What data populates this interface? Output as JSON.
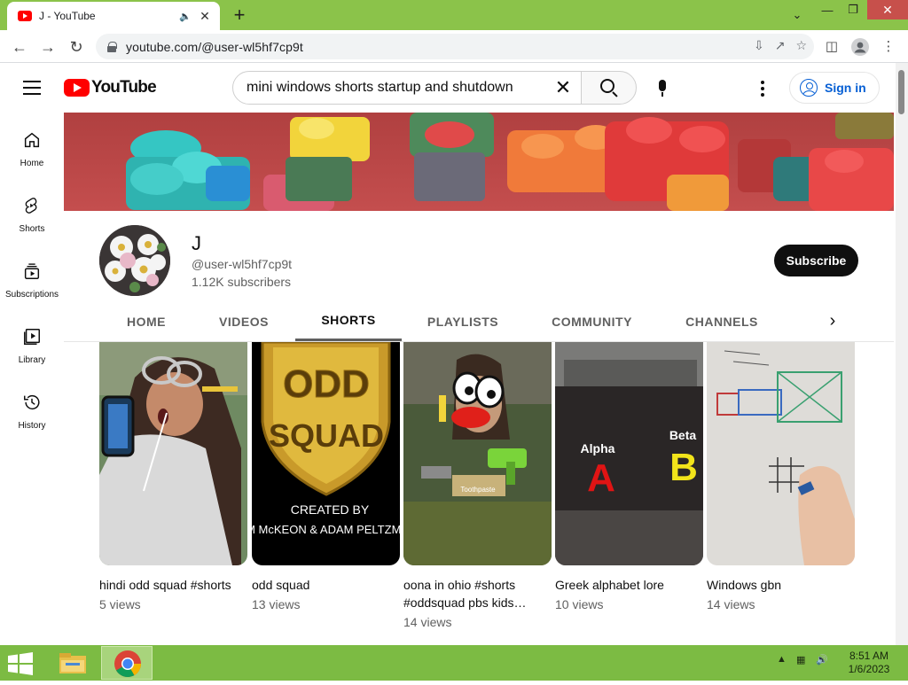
{
  "browser": {
    "tab_title": "J - YouTube",
    "url": "youtube.com/@user-wl5hf7cp9t"
  },
  "header": {
    "logo_text": "YouTube",
    "search_value": "mini windows shorts startup and shutdown",
    "signin_label": "Sign in"
  },
  "sidebar": {
    "items": [
      {
        "label": "Home",
        "icon": "home-icon"
      },
      {
        "label": "Shorts",
        "icon": "shorts-icon"
      },
      {
        "label": "Subscriptions",
        "icon": "subscriptions-icon"
      },
      {
        "label": "Library",
        "icon": "library-icon"
      },
      {
        "label": "History",
        "icon": "history-icon"
      }
    ]
  },
  "channel": {
    "name": "J",
    "handle": "@user-wl5hf7cp9t",
    "subscribers": "1.12K subscribers",
    "subscribe_label": "Subscribe"
  },
  "tabs": [
    {
      "label": "HOME",
      "active": false
    },
    {
      "label": "VIDEOS",
      "active": false
    },
    {
      "label": "SHORTS",
      "active": true
    },
    {
      "label": "PLAYLISTS",
      "active": false
    },
    {
      "label": "COMMUNITY",
      "active": false
    },
    {
      "label": "CHANNELS",
      "active": false
    }
  ],
  "shorts": [
    {
      "title": "hindi odd squad #shorts",
      "views": "5 views"
    },
    {
      "title": "odd squad",
      "views": "13 views"
    },
    {
      "title": "oona in ohio #shorts #oddsquad pbs kids…",
      "views": "14 views"
    },
    {
      "title": "Greek alphabet lore",
      "views": "10 views"
    },
    {
      "title": "Windows gbn",
      "views": "14 views"
    }
  ],
  "thumb_text": {
    "odd_line1": "ODD",
    "odd_line2": "SQUAD",
    "created_by": "CREATED BY",
    "creators": "TIM McKEON & ADAM PELTZMAN",
    "toothpaste": "Toothpaste",
    "alpha_label": "Alpha",
    "alpha_letter": "A",
    "beta_label": "Beta",
    "beta_letter": "B"
  },
  "taskbar": {
    "time": "8:51 AM",
    "date": "1/6/2023"
  },
  "colors": {
    "accent_link": "#065fd4",
    "youtube_red": "#ff0000",
    "title_bar": "#8bc34a",
    "taskbar": "#7cbb43"
  }
}
